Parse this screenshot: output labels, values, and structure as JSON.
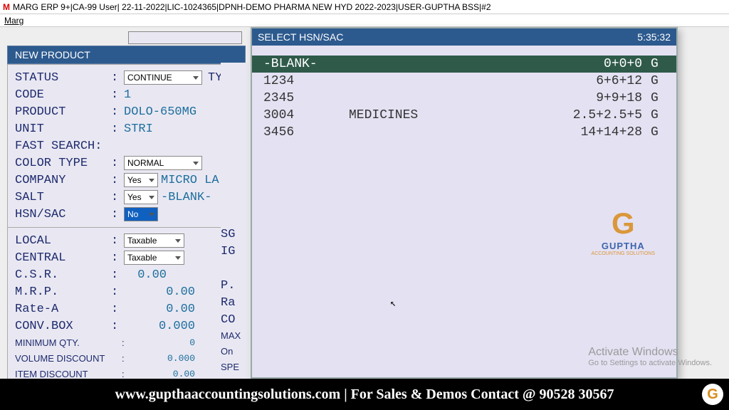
{
  "titlebar": "MARG ERP 9+|CA-99 User| 22-11-2022|LIC-1024365|DPNH-DEMO PHARMA NEW HYD 2022-2023|USER-GUPTHA BSS|#2",
  "menu": {
    "item": "Marg"
  },
  "panel": {
    "title": "NEW PRODUCT",
    "fields": {
      "status_label": "STATUS",
      "status_value": "CONTINUE",
      "ty_label": "TY",
      "code_label": "CODE",
      "code_value": "1",
      "product_label": "PRODUCT",
      "product_value": "DOLO-650MG",
      "unit_label": "UNIT",
      "unit_value": "STRI",
      "fast_label": "FAST SEARCH:",
      "color_label": "COLOR TYPE",
      "color_value": "NORMAL",
      "company_label": "COMPANY",
      "company_value": "Yes",
      "company_text": "MICRO LA",
      "salt_label": "SALT",
      "salt_value": "Yes",
      "salt_text": "-BLANK-",
      "hsn_label": "HSN/SAC",
      "hsn_value": "No",
      "local_label": "LOCAL",
      "local_value": "Taxable",
      "central_label": "CENTRAL",
      "central_value": "Taxable",
      "csr_label": "C.S.R.",
      "csr_value": "0.00",
      "mrp_label": "M.R.P.",
      "mrp_value": "0.00",
      "ratea_label": "Rate-A",
      "ratea_value": "0.00",
      "conv_label": "CONV.BOX",
      "conv_value": "0.000",
      "minq_label": "MINIMUM QTY.",
      "minq_value": "0",
      "vold_label": "VOLUME DISCOUNT",
      "vold_value": "0.000",
      "itemd_label": "ITEM DISCOUNT",
      "itemd_value": "0.00"
    },
    "rightcol": {
      "sg": "SG",
      "ig": "IG",
      "p": "P.",
      "ra": "Ra",
      "co": "CO",
      "max": "MAX",
      "on": "On",
      "spe": "SPE"
    }
  },
  "popup": {
    "title": "SELECT HSN/SAC",
    "time": "5:35:32",
    "items": [
      {
        "code": "-BLANK-",
        "desc": "",
        "rate": "0+0+0",
        "flag": "G"
      },
      {
        "code": "1234",
        "desc": "",
        "rate": "6+6+12",
        "flag": "G"
      },
      {
        "code": "2345",
        "desc": "",
        "rate": "9+9+18",
        "flag": "G"
      },
      {
        "code": "3004",
        "desc": "MEDICINES",
        "rate": "2.5+2.5+5",
        "flag": "G"
      },
      {
        "code": "3456",
        "desc": "",
        "rate": "14+14+28",
        "flag": "G"
      }
    ]
  },
  "watermark": {
    "brand": "GUPTHA",
    "sub": "ACCOUNTING SOLUTIONS"
  },
  "activate": {
    "l1": "Activate Windows",
    "l2": "Go to Settings to activate Windows."
  },
  "footer": "www.gupthaaccountingsolutions.com | For Sales & Demos Contact @ 90528 30567"
}
